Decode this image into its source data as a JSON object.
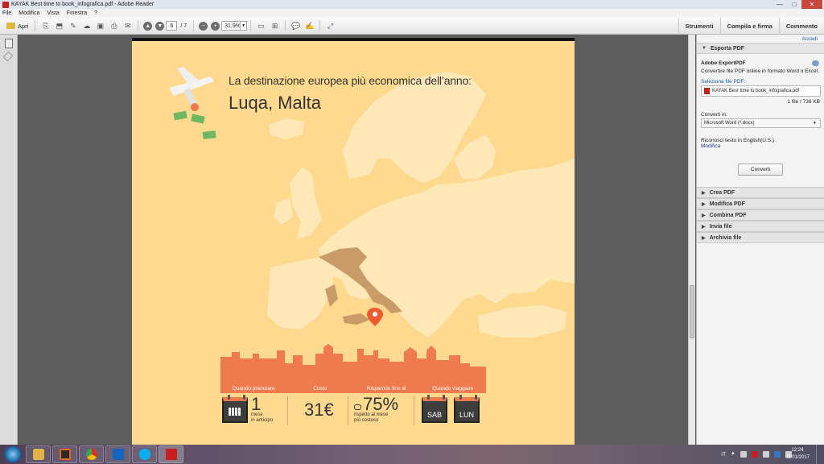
{
  "window": {
    "title": "KAYAK Best time to book_infografica.pdf - Adobe Reader",
    "minimize": "—",
    "maximize": "□",
    "close": "✕"
  },
  "menu": [
    "File",
    "Modifica",
    "Vista",
    "Finestra",
    "?"
  ],
  "toolbar": {
    "open_label": "Apri",
    "page_current": "6",
    "page_total": "/ 7",
    "zoom": "31,9%",
    "right_links": [
      "Strumenti",
      "Compila e firma",
      "Commento"
    ]
  },
  "document": {
    "headline": "La destinazione europea più economica dell’anno:",
    "city": "Luqa, Malta",
    "info_headers": [
      "Quando prenotare",
      "Costo",
      "Risparmio fino al",
      "Quando viaggiare"
    ],
    "book_number": "1",
    "book_desc_1": "mese",
    "book_desc_2": "in anticipo",
    "cost": "31€",
    "savings": "75%",
    "savings_desc_1": "rispetto al mese",
    "savings_desc_2": "più costoso",
    "day_1": "SAB",
    "day_2": "LUN",
    "colors": {
      "background": "#ffd98e",
      "land": "#ffe8b8",
      "italy": "#c99b67",
      "accent": "#ef7a4d"
    }
  },
  "panel": {
    "accedi": "Accedi",
    "esporta_header": "Esporta PDF",
    "export_title": "Adobe ExportPDF",
    "export_desc": "Convertire file PDF online in formato Word o Excel.",
    "select_file_label": "Seleziona file PDF:",
    "file_name": "KAYAK Best time to book_infografica.pdf",
    "file_info": "1 file / 736 KB",
    "convert_label": "Converti in:",
    "convert_value": "Microsoft Word (*.docx)",
    "ocr_text": "Riconosci testo in English(U.S.)",
    "ocr_link": "Modifica",
    "convert_button": "Converti",
    "sections": [
      "Crea PDF",
      "Modifica PDF",
      "Combina PDF",
      "Invia file",
      "Archivia file"
    ]
  },
  "taskbar": {
    "language": "IT",
    "time": "12:24",
    "date": "03/01/2017",
    "apps": [
      "file-explorer",
      "media-player",
      "chrome",
      "outlook",
      "skype",
      "adobe-reader"
    ]
  }
}
